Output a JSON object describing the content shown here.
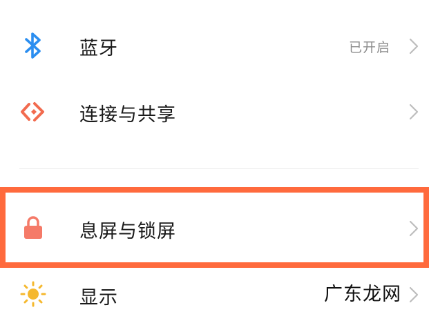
{
  "settings": {
    "items": [
      {
        "label": "蓝牙",
        "status": "已开启",
        "icon": "bluetooth-icon",
        "icon_color": "#2b8ef0"
      },
      {
        "label": "连接与共享",
        "status": "",
        "icon": "connection-share-icon",
        "icon_color": "#f26b4f"
      },
      {
        "label": "息屏与锁屏",
        "status": "",
        "icon": "lock-icon",
        "icon_color": "#f57a68"
      },
      {
        "label": "显示",
        "status": "",
        "icon": "sun-icon",
        "icon_color": "#f5b82e"
      }
    ]
  },
  "highlight_color": "#ff6a3d",
  "watermark": "广东龙网"
}
